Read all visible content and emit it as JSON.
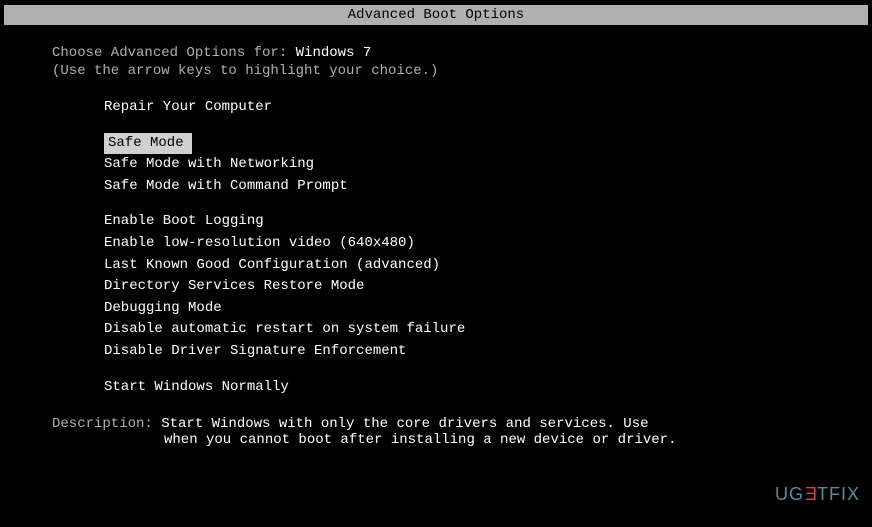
{
  "title": "Advanced Boot Options",
  "header": {
    "prefix": "Choose Advanced Options for: ",
    "os": "Windows 7",
    "hint": "(Use the arrow keys to highlight your choice.)"
  },
  "menu": {
    "group1": [
      "Repair Your Computer"
    ],
    "group2": [
      "Safe Mode",
      "Safe Mode with Networking",
      "Safe Mode with Command Prompt"
    ],
    "group3": [
      "Enable Boot Logging",
      "Enable low-resolution video (640x480)",
      "Last Known Good Configuration (advanced)",
      "Directory Services Restore Mode",
      "Debugging Mode",
      "Disable automatic restart on system failure",
      "Disable Driver Signature Enforcement"
    ],
    "group4": [
      "Start Windows Normally"
    ],
    "selected_index": 1
  },
  "description": {
    "label": "Description: ",
    "line1": "Start Windows with only the core drivers and services. Use",
    "line2": "when you cannot boot after installing a new device or driver."
  },
  "watermark": {
    "part1": "UG",
    "part2": "E",
    "part3": "TFIX"
  }
}
